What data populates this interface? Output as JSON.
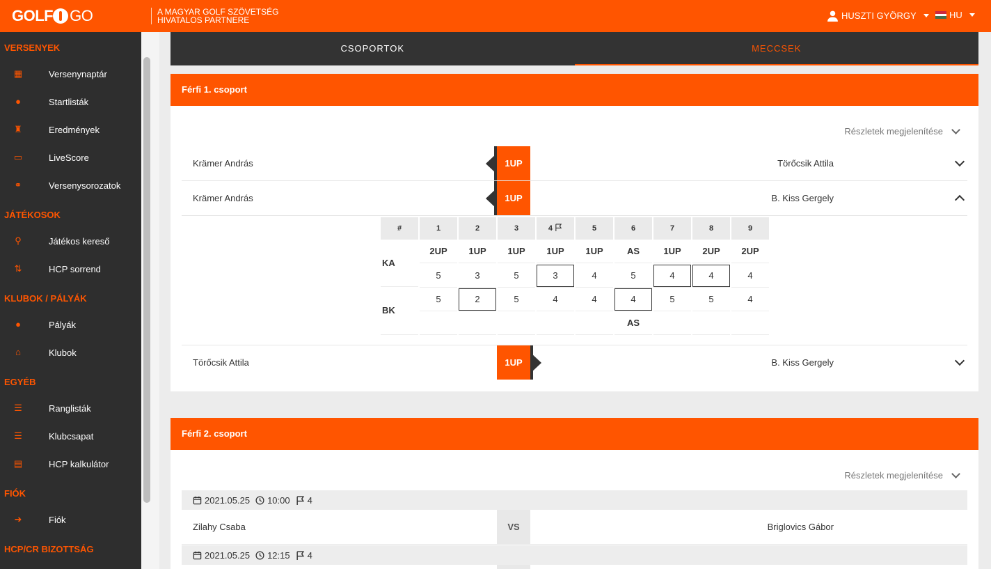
{
  "header": {
    "logo_bold": "GOLF",
    "logo_thin": "GO",
    "partner_line1": "A MAGYAR GOLF SZÖVETSÉG",
    "partner_line2": "HIVATALOS PARTNERE",
    "user_name": "HUSZTI GYÖRGY",
    "lang": "HU"
  },
  "sidebar": {
    "sections": [
      {
        "title": "VERSENYEK",
        "items": [
          {
            "label": "Versenynaptár",
            "icon": "calendar-icon"
          },
          {
            "label": "Startlisták",
            "icon": "golf-ball-icon"
          },
          {
            "label": "Eredmények",
            "icon": "trophy-icon"
          },
          {
            "label": "LiveScore",
            "icon": "cast-icon"
          },
          {
            "label": "Versenysorozatok",
            "icon": "link-icon"
          }
        ]
      },
      {
        "title": "JÁTÉKOSOK",
        "items": [
          {
            "label": "Játékos kereső",
            "icon": "running-icon"
          },
          {
            "label": "HCP sorrend",
            "icon": "sort-icon"
          }
        ]
      },
      {
        "title": "KLUBOK / PÁLYÁK",
        "items": [
          {
            "label": "Pályák",
            "icon": "golf-ball-icon"
          },
          {
            "label": "Klubok",
            "icon": "institution-icon"
          }
        ]
      },
      {
        "title": "EGYÉB",
        "items": [
          {
            "label": "Ranglisták",
            "icon": "list-icon"
          },
          {
            "label": "Klubcsapat",
            "icon": "list-icon"
          },
          {
            "label": "HCP kalkulátor",
            "icon": "calculator-icon"
          }
        ]
      },
      {
        "title": "FIÓK",
        "items": [
          {
            "label": "Fiók",
            "icon": "sign-in-icon"
          }
        ]
      },
      {
        "title": "HCP/CR BIZOTTSÁG",
        "items": []
      }
    ]
  },
  "tabs": {
    "groups": "CSOPORTOK",
    "matches": "MECCSEK"
  },
  "group1": {
    "title": "Férfi 1. csoport",
    "details_label": "Részletek megjelenítése",
    "matches": [
      {
        "p1": "Krämer András",
        "p2": "Törőcsik Attila",
        "score": "1UP"
      },
      {
        "p1": "Krämer András",
        "p2": "B. Kiss Gergely",
        "score": "1UP"
      },
      {
        "p1": "Törőcsik Attila",
        "p2": "B. Kiss Gergely",
        "score": "1UP"
      }
    ],
    "scorecard": {
      "hash": "#",
      "holes": [
        "1",
        "2",
        "3",
        "4",
        "5",
        "6",
        "7",
        "8",
        "9"
      ],
      "player_a": "KA",
      "player_b": "BK",
      "status_a": [
        "2UP",
        "1UP",
        "1UP",
        "1UP",
        "1UP",
        "AS",
        "1UP",
        "2UP",
        "2UP"
      ],
      "scores_a": [
        "5",
        "3",
        "5",
        "3",
        "4",
        "5",
        "4",
        "4",
        "4"
      ],
      "scores_b": [
        "5",
        "2",
        "5",
        "4",
        "4",
        "4",
        "5",
        "5",
        "4"
      ],
      "status_b": [
        "",
        "",
        "",
        "",
        "",
        "AS",
        "",
        "",
        ""
      ]
    }
  },
  "group2": {
    "title": "Férfi 2. csoport",
    "details_label": "Részletek megjelenítése",
    "fixtures": [
      {
        "date": "2021.05.25",
        "time": "10:00",
        "hole": "4",
        "p1": "Zilahy Csaba",
        "p2": "Briglovics Gábor",
        "vs": "VS"
      },
      {
        "date": "2021.05.25",
        "time": "12:15",
        "hole": "4"
      }
    ]
  }
}
